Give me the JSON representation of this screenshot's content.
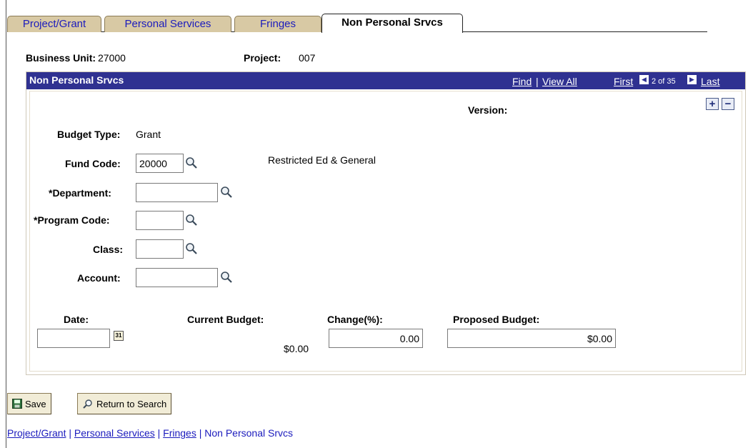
{
  "tabs": [
    {
      "label": "Project/Grant"
    },
    {
      "label": "Personal Services"
    },
    {
      "label": "Fringes"
    },
    {
      "label": "Non Personal Srvcs"
    }
  ],
  "header": {
    "business_unit_label": "Business Unit:",
    "business_unit_value": "27000",
    "project_label": "Project:",
    "project_value": "007"
  },
  "panel": {
    "title": "Non Personal Srvcs",
    "find_label": "Find",
    "separator": "|",
    "view_all_label": "View All",
    "first_label": "First",
    "page_indicator": "2 of 35",
    "last_label": "Last",
    "version_label": "Version:",
    "add_row": "+",
    "delete_row": "−"
  },
  "form": {
    "budget_type_label": "Budget Type:",
    "budget_type_value": "Grant",
    "fund_code_label": "Fund Code:",
    "fund_code_value": "20000",
    "fund_code_description": "Restricted Ed & General",
    "department_label": "*Department:",
    "department_value": "",
    "program_code_label": "*Program Code:",
    "program_code_value": "",
    "class_label": "Class:",
    "class_value": "",
    "account_label": "Account:",
    "account_value": "",
    "date_label": "Date:",
    "date_value": "",
    "calendar_day": "31",
    "current_budget_label": "Current Budget:",
    "current_budget_value": "$0.00",
    "change_label": "Change(%):",
    "change_value": "0.00",
    "proposed_budget_label": "Proposed Budget:",
    "proposed_budget_value": "$0.00"
  },
  "actions": {
    "save_label": "Save",
    "return_label": "Return to Search"
  },
  "footer_links": [
    {
      "label": "Project/Grant"
    },
    {
      "label": "Personal Services"
    },
    {
      "label": "Fringes"
    },
    {
      "label": "Non Personal Srvcs"
    }
  ],
  "colors": {
    "panel_bar": "#2f3191",
    "tab_inactive": "#d8c9a4",
    "link": "#1b1bbd"
  },
  "icons": {
    "lookup": "magnifier-icon",
    "calendar": "calendar-icon",
    "save": "save-icon",
    "return": "search-return-icon"
  }
}
